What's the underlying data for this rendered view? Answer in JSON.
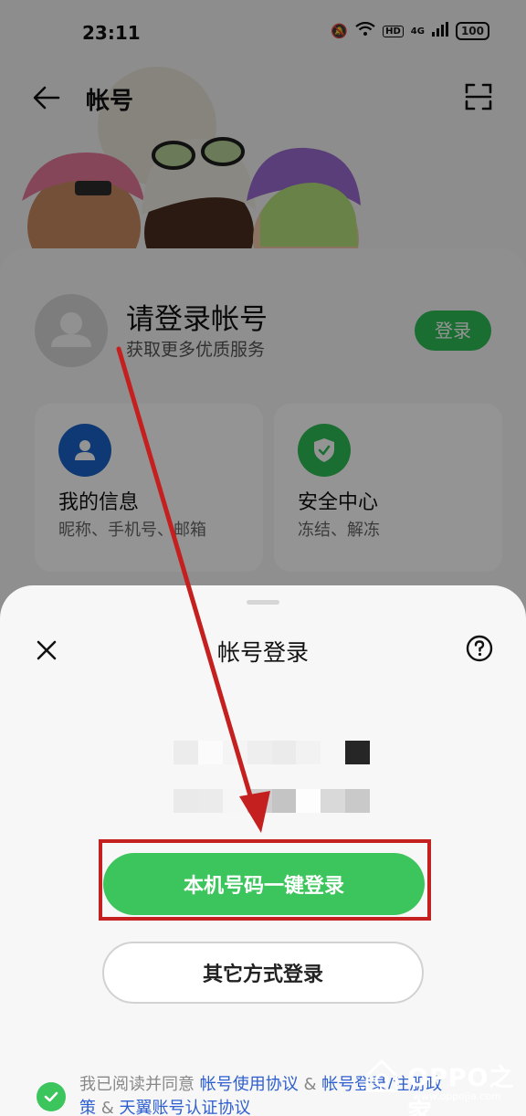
{
  "status": {
    "time": "23:11",
    "hd": "HD",
    "net": "4G",
    "battery": "100"
  },
  "header": {
    "title": "帐号"
  },
  "profile": {
    "title": "请登录帐号",
    "subtitle": "获取更多优质服务",
    "login_button": "登录"
  },
  "tiles": [
    {
      "title": "我的信息",
      "subtitle": "昵称、手机号、邮箱",
      "icon": "person-icon",
      "color": "#1a63c9"
    },
    {
      "title": "安全中心",
      "subtitle": "冻结、解冻",
      "icon": "shield-check-icon",
      "color": "#2ebd57"
    }
  ],
  "sheet": {
    "title": "帐号登录",
    "primary_button": "本机号码一键登录",
    "secondary_button": "其它方式登录",
    "agreement": {
      "prefix": "我已阅读并同意 ",
      "link1": "帐号使用协议",
      "sep1": " & ",
      "link2": "帐号登录/注册政策",
      "sep2": " & ",
      "link3": "天翼账号认证协议"
    }
  },
  "watermark": {
    "text": "OPPO之家",
    "sub": "www.oppojia.com"
  },
  "colors": {
    "accent": "#3cc55c",
    "annotation": "#c52020",
    "link": "#2e5fd0"
  }
}
